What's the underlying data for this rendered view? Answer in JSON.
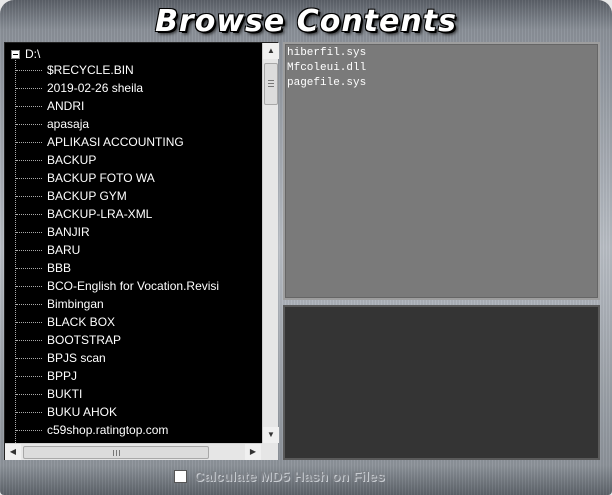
{
  "app": {
    "title": "Browse Contents"
  },
  "tree": {
    "root": "D:\\",
    "items": [
      "$RECYCLE.BIN",
      "2019-02-26 sheila",
      "ANDRI",
      "apasaja",
      "APLIKASI ACCOUNTING",
      "BACKUP",
      "BACKUP FOTO WA",
      "BACKUP GYM",
      "BACKUP-LRA-XML",
      "BANJIR",
      "BARU",
      "BBB",
      "BCO-English for  Vocation.Revisi",
      "Bimbingan",
      "BLACK BOX",
      "BOOTSTRAP",
      "BPJS scan",
      "BPPJ",
      "BUKTI",
      "BUKU AHOK",
      "c59shop.ratingtop.com"
    ]
  },
  "files": {
    "items": [
      "hiberfil.sys",
      "Mfcoleui.dll",
      "pagefile.sys"
    ]
  },
  "options": {
    "md5_label": "Calculate MD5 Hash on Files",
    "md5_checked": false
  },
  "icons": {
    "scroll_up": "▲",
    "scroll_down": "▼",
    "scroll_left": "◀",
    "scroll_right": "▶"
  },
  "colors": {
    "tree_bg": "#000000",
    "file_list_bg": "#7a7a7a",
    "preview_bg": "#343434",
    "label_gray": "#7d8187"
  }
}
